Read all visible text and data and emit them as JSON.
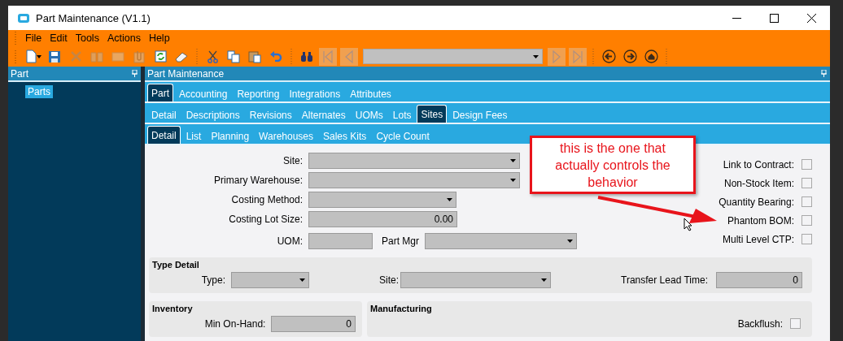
{
  "window": {
    "title": "Part Maintenance (V1.1)"
  },
  "menu": [
    "File",
    "Edit",
    "Tools",
    "Actions",
    "Help"
  ],
  "toolbar": [
    {
      "kind": "new",
      "disabled": false
    },
    {
      "kind": "save",
      "disabled": false
    },
    {
      "kind": "delete",
      "disabled": true
    },
    {
      "kind": "book",
      "disabled": true
    },
    {
      "kind": "note",
      "disabled": true
    },
    {
      "kind": "attach",
      "disabled": true
    },
    {
      "kind": "refresh",
      "disabled": false
    },
    {
      "kind": "eraser",
      "disabled": false
    },
    {
      "kind": "separator"
    },
    {
      "kind": "cut",
      "disabled": false
    },
    {
      "kind": "copy",
      "disabled": false
    },
    {
      "kind": "paste",
      "disabled": false
    },
    {
      "kind": "undo",
      "disabled": false
    },
    {
      "kind": "separator"
    },
    {
      "kind": "search",
      "disabled": false
    },
    {
      "kind": "first",
      "disabled": true
    },
    {
      "kind": "prev",
      "disabled": true
    },
    {
      "kind": "selector",
      "disabled": true
    },
    {
      "kind": "next",
      "disabled": true
    },
    {
      "kind": "last",
      "disabled": true
    },
    {
      "kind": "separator"
    },
    {
      "kind": "back",
      "disabled": false
    },
    {
      "kind": "forward",
      "disabled": false
    },
    {
      "kind": "home",
      "disabled": false
    },
    {
      "kind": "separator"
    }
  ],
  "side_panel": {
    "title": "Part",
    "tree": [
      {
        "label": "Parts",
        "selected": true
      }
    ]
  },
  "main_panel": {
    "title": "Part Maintenance"
  },
  "tab_rows": [
    {
      "tabs": [
        {
          "label": "Part",
          "selected": true
        },
        {
          "label": "Accounting",
          "selected": false
        },
        {
          "label": "Reporting",
          "selected": false
        },
        {
          "label": "Integrations",
          "selected": false
        },
        {
          "label": "Attributes",
          "selected": false
        }
      ]
    },
    {
      "tabs": [
        {
          "label": "Detail",
          "selected": false
        },
        {
          "label": "Descriptions",
          "selected": false
        },
        {
          "label": "Revisions",
          "selected": false
        },
        {
          "label": "Alternates",
          "selected": false
        },
        {
          "label": "UOMs",
          "selected": false
        },
        {
          "label": "Lots",
          "selected": false
        },
        {
          "label": "Sites",
          "selected": true
        },
        {
          "label": "Design Fees",
          "selected": false
        }
      ]
    },
    {
      "tabs": [
        {
          "label": "Detail",
          "selected": true
        },
        {
          "label": "List",
          "selected": false
        },
        {
          "label": "Planning",
          "selected": false
        },
        {
          "label": "Warehouses",
          "selected": false
        },
        {
          "label": "Sales Kits",
          "selected": false
        },
        {
          "label": "Cycle Count",
          "selected": false
        }
      ]
    }
  ],
  "fields": [
    {
      "label": "Site:",
      "kind": "dropdown"
    },
    {
      "label": "Primary Warehouse:",
      "kind": "dropdown"
    },
    {
      "label": "Costing Method:",
      "kind": "dropdown"
    },
    {
      "label": "Costing Lot Size:",
      "kind": "text",
      "value": "0.00"
    },
    {
      "label": "UOM:",
      "kind": "text"
    },
    {
      "label": "Part Mgr",
      "kind": "dropdown"
    }
  ],
  "checkboxes": [
    {
      "label": "Link to Contract:",
      "checked": false
    },
    {
      "label": "Non-Stock Item:",
      "checked": false
    },
    {
      "label": "Quantity Bearing:",
      "checked": false
    },
    {
      "label": "Phantom BOM:",
      "checked": false
    },
    {
      "label": "Multi Level CTP:",
      "checked": false
    }
  ],
  "type_detail": {
    "title": "Type Detail",
    "fields": [
      {
        "label": "Type:",
        "kind": "dropdown"
      },
      {
        "label": "Site:",
        "kind": "dropdown"
      },
      {
        "label": "Transfer Lead Time:",
        "kind": "text",
        "value": "0"
      }
    ]
  },
  "inventory": {
    "title": "Inventory",
    "fields": [
      {
        "label": "Min On-Hand:",
        "kind": "text",
        "value": "0"
      }
    ]
  },
  "manufacturing": {
    "title": "Manufacturing",
    "checkboxes": [
      {
        "label": "Backflush:",
        "checked": false
      }
    ]
  },
  "callout": {
    "text": "this is the one that actually controls the behavior"
  }
}
